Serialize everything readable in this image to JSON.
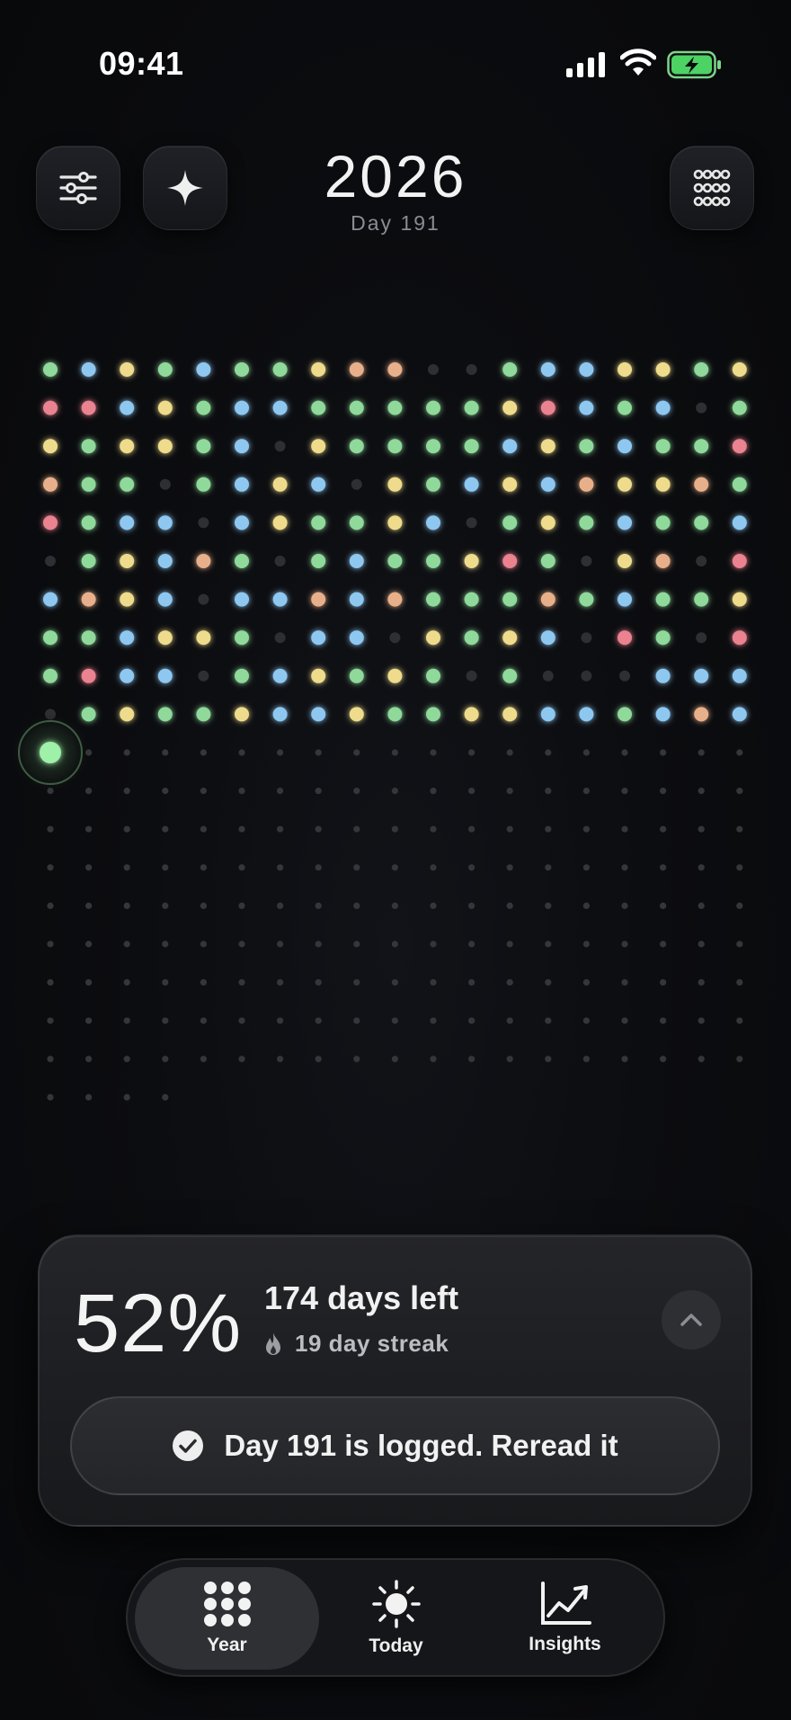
{
  "status_bar": {
    "time": "09:41"
  },
  "header": {
    "year": "2026",
    "day_label": "Day 191"
  },
  "grid": {
    "filled_days": 190,
    "current_day": 191,
    "total_dots": 365,
    "columns": 19,
    "colors": {
      "green": "#8fd99a",
      "blue": "#8ec8f0",
      "yellow": "#eedc8c",
      "orange": "#e8b08a",
      "red": "#ea8290",
      "empty": "#2d2f33",
      "future": "#34363a"
    },
    "day_colors": [
      "g",
      "b",
      "y",
      "g",
      "b",
      "g",
      "g",
      "y",
      "o",
      "o",
      "e",
      "e",
      "g",
      "b",
      "b",
      "y",
      "y",
      "g",
      "y",
      "r",
      "r",
      "b",
      "y",
      "g",
      "b",
      "b",
      "g",
      "g",
      "g",
      "g",
      "g",
      "y",
      "r",
      "b",
      "g",
      "b",
      "e",
      "g",
      "y",
      "g",
      "y",
      "y",
      "g",
      "b",
      "e",
      "y",
      "g",
      "g",
      "g",
      "g",
      "b",
      "y",
      "g",
      "b",
      "g",
      "g",
      "r",
      "o",
      "g",
      "g",
      "e",
      "g",
      "b",
      "y",
      "b",
      "e",
      "y",
      "g",
      "b",
      "y",
      "b",
      "o",
      "y",
      "y",
      "o",
      "g",
      "r",
      "g",
      "b",
      "b",
      "e",
      "b",
      "y",
      "g",
      "g",
      "y",
      "b",
      "e",
      "g",
      "y",
      "g",
      "b",
      "g",
      "g",
      "b",
      "e",
      "g",
      "y",
      "b",
      "o",
      "g",
      "e",
      "g",
      "b",
      "g",
      "g",
      "y",
      "r",
      "g",
      "e",
      "y",
      "o",
      "e",
      "r",
      "b",
      "o",
      "y",
      "b",
      "e",
      "b",
      "b",
      "o",
      "b",
      "o",
      "g",
      "g",
      "g",
      "o",
      "g",
      "b",
      "g",
      "g",
      "y",
      "g",
      "g",
      "b",
      "y",
      "y",
      "g",
      "e",
      "b",
      "b",
      "e",
      "y",
      "g",
      "y",
      "b",
      "e",
      "r",
      "g",
      "e",
      "r",
      "g",
      "r",
      "b",
      "b",
      "e",
      "g",
      "b",
      "y",
      "g",
      "y",
      "g",
      "e",
      "g",
      "e",
      "e",
      "e",
      "b",
      "b",
      "b",
      "e",
      "g",
      "y",
      "g",
      "g",
      "y",
      "b",
      "b",
      "y",
      "g",
      "g",
      "y",
      "y",
      "b",
      "b",
      "g",
      "b",
      "o",
      "b"
    ]
  },
  "progress": {
    "percent": "52%",
    "days_left": "174 days left",
    "streak": "19 day streak",
    "logged_message": "Day 191 is logged. Reread it"
  },
  "tabs": [
    {
      "label": "Year",
      "icon": "grid-dots-icon"
    },
    {
      "label": "Today",
      "icon": "sun-icon"
    },
    {
      "label": "Insights",
      "icon": "chart-line-icon"
    }
  ]
}
